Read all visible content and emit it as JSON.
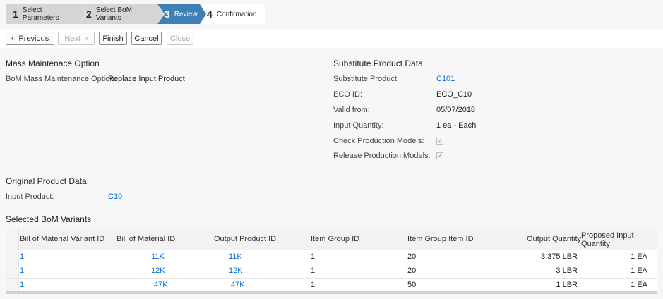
{
  "wizard": {
    "steps": [
      {
        "num": "1",
        "label": "Select Parameters"
      },
      {
        "num": "2",
        "label": "Select BoM Variants"
      },
      {
        "num": "3",
        "label": "Review"
      },
      {
        "num": "4",
        "label": "Confirmation"
      }
    ]
  },
  "toolbar": {
    "previous": "Previous",
    "next": "Next",
    "finish": "Finish",
    "cancel": "Cancel",
    "close": "Close"
  },
  "mass_maintenance": {
    "title": "Mass Maintenace Option",
    "option_label": "BoM Mass Maintenance Option:",
    "option_value": "Replace Input Product"
  },
  "substitute": {
    "title": "Substitute Product Data",
    "product_label": "Substitute Product:",
    "product_value": "C101",
    "eco_label": "ECO ID:",
    "eco_value": "ECO_C10",
    "valid_label": "Valid from:",
    "valid_value": "05/07/2018",
    "qty_label": "Input Quantity:",
    "qty_value": "1 ea - Each",
    "check_label": "Check Production Models:",
    "release_label": "Release Production Models:"
  },
  "original": {
    "title": "Original Product Data",
    "input_label": "Input Product:",
    "input_value": "C10"
  },
  "variants": {
    "title": "Selected BoM Variants",
    "columns": {
      "bom_variant_id": "Bill of Material Variant ID",
      "bom_id": "Bill of Material ID",
      "output_product_id": "Output Product ID",
      "item_group_id": "Item Group ID",
      "item_group_item_id": "Item Group Item ID",
      "output_quantity": "Output Quantity",
      "proposed_input_qty_1": "Proposed Input",
      "proposed_input_qty_2": "Quantity"
    },
    "rows": [
      {
        "variant": "1",
        "bom": "11K",
        "product": "11K",
        "group": "1",
        "item": "20",
        "out_qty": "3.375 LBR",
        "in_qty": "1 EA"
      },
      {
        "variant": "1",
        "bom": "12K",
        "product": "12K",
        "group": "1",
        "item": "20",
        "out_qty": "3 LBR",
        "in_qty": "1 EA"
      },
      {
        "variant": "1",
        "bom": "47K",
        "product": "47K",
        "group": "1",
        "item": "50",
        "out_qty": "1 LBR",
        "in_qty": "1 EA"
      }
    ]
  }
}
